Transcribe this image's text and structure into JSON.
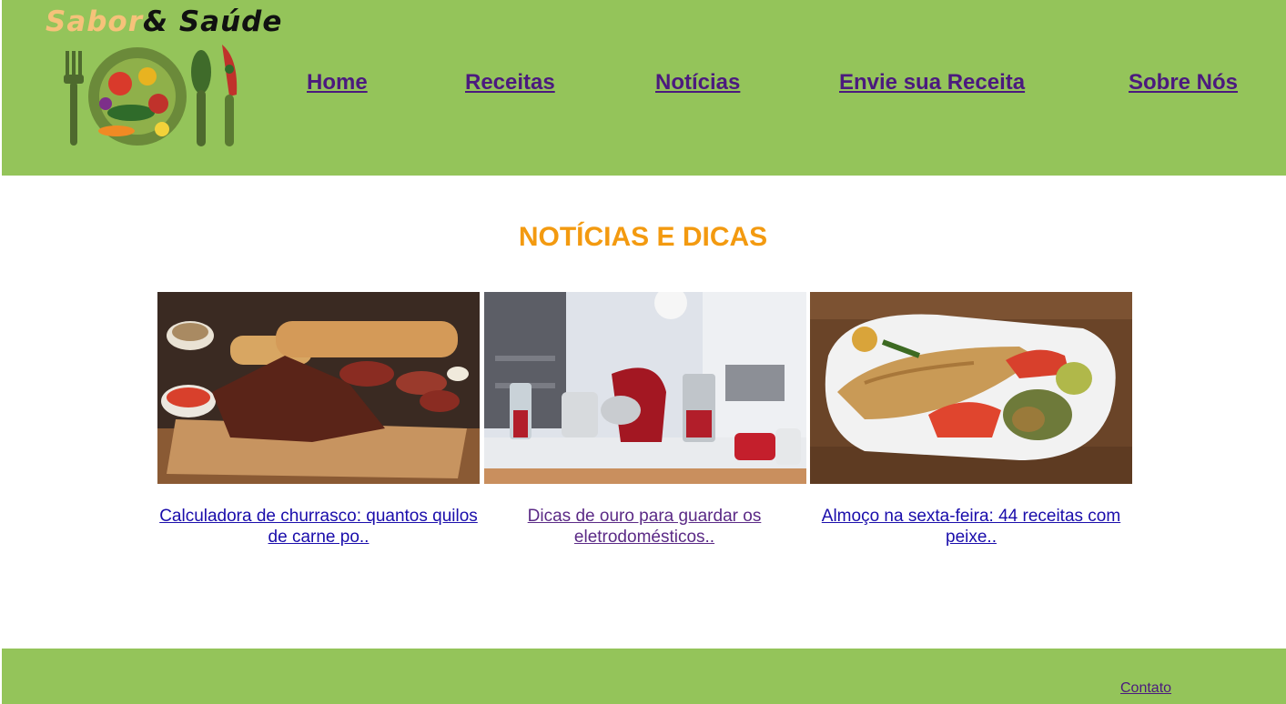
{
  "logo": {
    "word1": "Sabor",
    "word2": "& Saúde"
  },
  "nav": [
    {
      "label": "Home"
    },
    {
      "label": "Receitas"
    },
    {
      "label": "Notícias"
    },
    {
      "label": "Envie sua Receita"
    },
    {
      "label": "Sobre Nós"
    }
  ],
  "page_title": "NOTÍCIAS E DICAS",
  "cards": [
    {
      "image": "barbecue-meat-board-photo",
      "link": "Calculadora de churrasco: quantos quilos de carne po..",
      "link_color": "#1a0dab"
    },
    {
      "image": "kitchen-appliances-photo",
      "link": "Dicas de ouro para guardar os eletrodomésticos..",
      "link_color": "#5b2a86"
    },
    {
      "image": "grilled-fish-plate-photo",
      "link": "Almoço na sexta-feira: 44 receitas com peixe..",
      "link_color": "#1a0dab"
    }
  ],
  "footer": {
    "contact": "Contato"
  },
  "colors": {
    "header_bg": "#94c45a",
    "title": "#f39a10",
    "nav": "#4b1a7e"
  }
}
